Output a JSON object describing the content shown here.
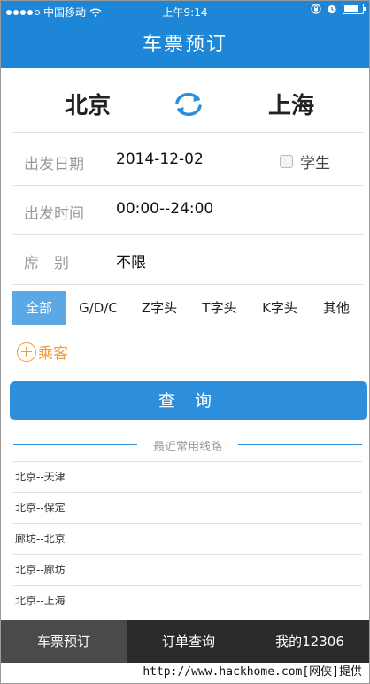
{
  "status_bar": {
    "carrier": "中国移动",
    "time": "上午9:14",
    "signal_bars_filled": 4,
    "signal_bars_total": 5,
    "battery_level": 0.9
  },
  "header": {
    "title": "车票预订"
  },
  "stations": {
    "from": "北京",
    "to": "上海",
    "swap_icon": "swap-arrows-icon"
  },
  "form": {
    "date_label": "出发日期",
    "date_value": "2014-12-02",
    "student_label": "学生",
    "time_label": "出发时间",
    "time_value": "00:00--24:00",
    "seat_label": "席　别",
    "seat_value": "不限"
  },
  "train_types": [
    "全部",
    "G/D/C",
    "Z字头",
    "T字头",
    "K字头",
    "其他"
  ],
  "passenger_label": "乘客",
  "query_button": "查 询",
  "recent": {
    "title": "最近常用线路",
    "routes": [
      "北京--天津",
      "北京--保定",
      "廊坊--北京",
      "北京--廊坊",
      "北京--上海"
    ]
  },
  "bottom_tabs": [
    "车票预订",
    "订单查询",
    "我的12306"
  ],
  "watermark": "http://www.hackhome.com[网侠]提供",
  "colors": {
    "primary": "#1e86d6",
    "accent": "#f29a34",
    "tab_active": "#5aa8e6",
    "bottom_bar": "#2b2b2b"
  }
}
